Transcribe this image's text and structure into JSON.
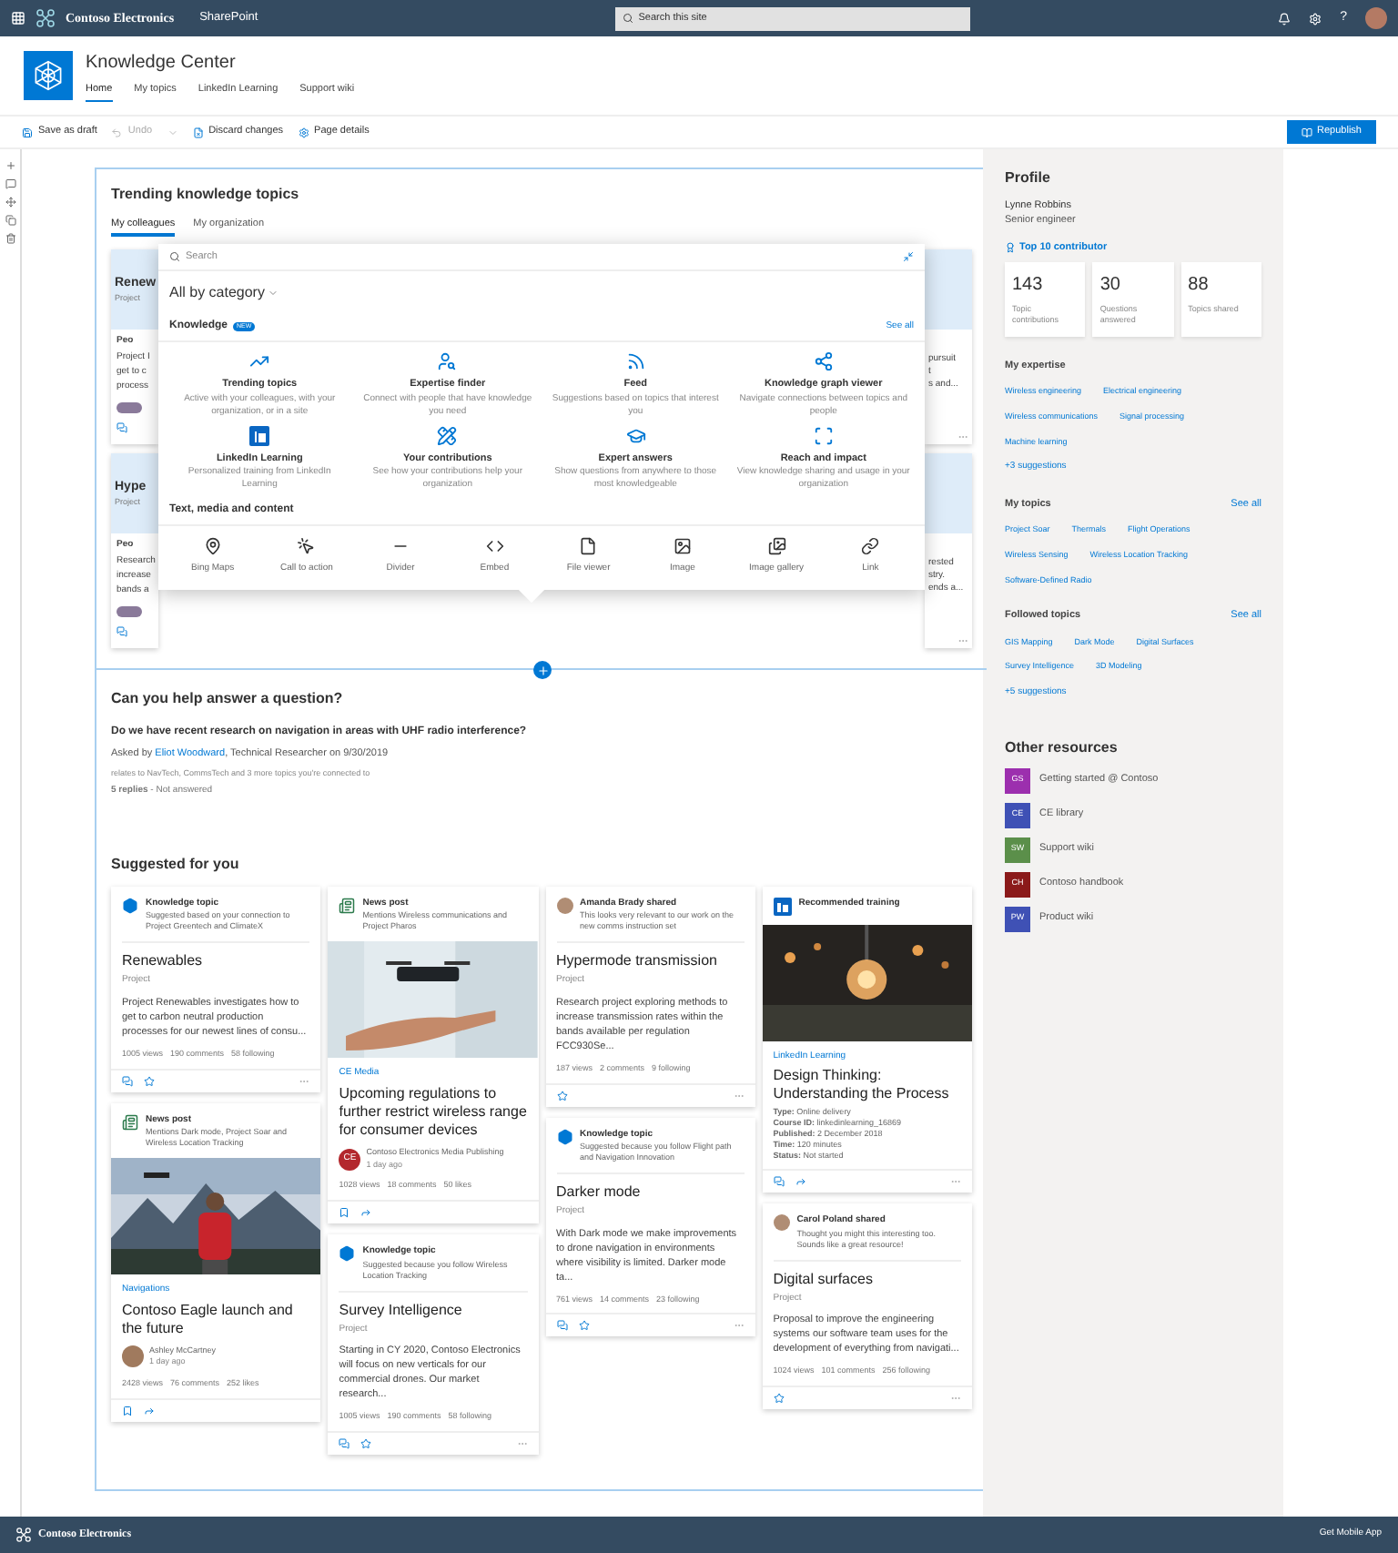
{
  "top_bar": {
    "brand": "Contoso Electronics",
    "app": "SharePoint",
    "search_placeholder": "Search this site",
    "help": "?"
  },
  "site": {
    "title": "Knowledge Center",
    "nav": [
      {
        "label": "Home",
        "selected": true
      },
      {
        "label": "My topics",
        "selected": false
      },
      {
        "label": "LinkedIn Learning",
        "selected": false
      },
      {
        "label": "Support wiki",
        "selected": false
      }
    ]
  },
  "command_bar": {
    "actions": [
      {
        "label": "Save as draft",
        "disabled": false
      },
      {
        "label": "Undo",
        "disabled": true
      },
      {
        "label": "Discard changes",
        "disabled": false
      },
      {
        "label": "Page details",
        "disabled": false
      }
    ],
    "publish": "Republish"
  },
  "trending": {
    "title": "Trending knowledge topics",
    "tabs": [
      {
        "label": "My colleagues",
        "selected": true
      },
      {
        "label": "My organization",
        "selected": false
      }
    ],
    "cards": [
      {
        "title": "Renew",
        "label": "Project",
        "source": "Peo",
        "body": [
          "Project I",
          "get to c",
          "process"
        ],
        "tail": [
          "pursuit",
          "t",
          "s and..."
        ]
      },
      {
        "title": "Hype",
        "label": "Project",
        "source": "Peo",
        "body": [
          "Research",
          "increase",
          "bands a"
        ],
        "tail": [
          "rested",
          "stry.",
          "ends a..."
        ]
      }
    ]
  },
  "toolbox": {
    "search_placeholder": "Search",
    "category": "All by category",
    "knowledge": {
      "title": "Knowledge",
      "badge": "NEW",
      "see_all": "See all",
      "items": [
        {
          "title": "Trending topics",
          "description": "Active with your colleagues, with your organization, or in a site"
        },
        {
          "title": "Expertise finder",
          "description": "Connect with people that have knowledge you need"
        },
        {
          "title": "Feed",
          "description": "Suggestions based on topics that interest you"
        },
        {
          "title": "Knowledge graph viewer",
          "description": "Navigate connections between topics and people"
        },
        {
          "title": "LinkedIn Learning",
          "description": "Personalized training from LinkedIn Learning"
        },
        {
          "title": "Your contributions",
          "description": "See how your contributions help your organization"
        },
        {
          "title": "Expert answers",
          "description": "Show questions from anywhere to those most knowledgeable"
        },
        {
          "title": "Reach and impact",
          "description": "View knowledge sharing and usage in your organization"
        }
      ]
    },
    "media": {
      "title": "Text, media and content",
      "items": [
        "Bing Maps",
        "Call to action",
        "Divider",
        "Embed",
        "File viewer",
        "Image",
        "Image gallery",
        "Link"
      ]
    }
  },
  "question": {
    "title": "Can you help answer a question?",
    "text": "Do we have recent research on navigation in areas with UHF radio interference?",
    "asked_prefix": "Asked by ",
    "asker": "Eliot Woodward",
    "asked_suffix": ", Technical Researcher on 9/30/2019",
    "relates": "relates to NavTech, CommsTech and 3 more topics you're connected to",
    "status": "**5 replies** - Not answered"
  },
  "suggested": {
    "title": "Suggested for you",
    "columns": [
      [
        {
          "kind": "topic",
          "header": "Knowledge topic",
          "subheader": "Suggested based on your connection to Project Greentech and ClimateX",
          "title": "Renewables",
          "label": "Project",
          "body": "Project Renewables investigates how to get to carbon neutral production processes for our newest lines of consu...",
          "stats": [
            "1005 views",
            "190 comments",
            "58 following"
          ],
          "actions": [
            {
              "kind": "comment"
            },
            {
              "kind": "star"
            }
          ]
        },
        {
          "kind": "news",
          "header": "News post",
          "subheader": "Mentions Dark mode, Project Soar and Wireless Location Tracking",
          "picture": true,
          "tag": "Navigations",
          "title": "Contoso Eagle launch and the future",
          "author": {
            "name": "Ashley McCartney",
            "time": "1 day ago"
          },
          "stats": [
            "2428 views",
            "76 comments",
            "252 likes"
          ],
          "actions": [
            {
              "kind": "bookmark"
            },
            {
              "kind": "share"
            }
          ]
        }
      ],
      [
        {
          "kind": "news",
          "header": "News post",
          "subheader": "Mentions Wireless communications and Project Pharos",
          "picture": true,
          "tag": "CE Media",
          "title": "Upcoming regulations to further restrict wireless range for consumer devices",
          "author": {
            "initials": "CE",
            "name": "Contoso Electronics Media Publishing",
            "time": "1 day ago"
          },
          "stats": [
            "1028 views",
            "18 comments",
            "50 likes"
          ],
          "actions": [
            {
              "kind": "bookmark"
            },
            {
              "kind": "share"
            }
          ]
        },
        {
          "kind": "topic",
          "header": "Knowledge topic",
          "subheader": "Suggested because you follow Wireless Location Tracking",
          "title": "Survey Intelligence",
          "label": "Project",
          "body": "Starting in CY 2020, Contoso Electronics will focus on new verticals for our commercial drones. Our market research...",
          "stats": [
            "1005 views",
            "190 comments",
            "58 following"
          ],
          "actions": [
            {
              "kind": "comment"
            },
            {
              "kind": "star"
            }
          ]
        }
      ],
      [
        {
          "kind": "shared",
          "header": "Amanda Brady shared",
          "subheader": "This looks very relevant to our work on the new comms instruction set",
          "title": "Hypermode transmission",
          "label": "Project",
          "body": "Research project exploring methods to increase transmission rates within the bands available per regulation FCC930Se...",
          "stats": [
            "187 views",
            "2 comments",
            "9 following"
          ],
          "actions": [
            {
              "kind": "star"
            }
          ]
        },
        {
          "kind": "topic",
          "header": "Knowledge topic",
          "subheader": "Suggested because you follow Flight path and Navigation Innovation",
          "title": "Darker mode",
          "label": "Project",
          "body": "With Dark mode we make improvements to drone navigation in environments where visibility is limited. Darker mode ta...",
          "stats": [
            "761 views",
            "14 comments",
            "23 following"
          ],
          "actions": [
            {
              "kind": "comment"
            },
            {
              "kind": "star"
            }
          ]
        }
      ],
      [
        {
          "kind": "training",
          "header": "Recommended training",
          "picture": true,
          "title": "Design Thinking: Understanding the Process",
          "tag": "LinkedIn Learning",
          "details": [
            "**Type:** Online delivery",
            "**Course ID:** linkedinlearning_16869",
            "**Published:** 2 December 2018",
            "**Time:** 120 minutes",
            "**Status:** Not started"
          ],
          "actions": [
            {
              "kind": "comment"
            },
            {
              "kind": "share"
            }
          ]
        },
        {
          "kind": "shared",
          "header": "Carol Poland shared",
          "subheader": "Thought you might this interesting too. Sounds like a great resource!",
          "title": "Digital surfaces",
          "label": "Project",
          "body": "Proposal to improve the engineering systems our software team uses for the development of everything from navigati...",
          "stats": [
            "1024 views",
            "101 comments",
            "256 following"
          ],
          "actions": [
            {
              "kind": "star"
            }
          ]
        }
      ]
    ]
  },
  "profile": {
    "title": "Profile",
    "name": "Lynne Robbins",
    "role": "Senior engineer",
    "badge": "Top 10 contributor",
    "stats": [
      {
        "value": "143",
        "label": "Topic contributions"
      },
      {
        "value": "30",
        "label": "Questions answered"
      },
      {
        "value": "88",
        "label": "Topics shared"
      }
    ],
    "groups": [
      {
        "title": "My expertise",
        "tags": [
          "Wireless engineering",
          "Electrical engineering",
          "Wireless communications",
          "Signal processing",
          "Machine learning"
        ],
        "more": "+3 suggestions"
      },
      {
        "title": "My topics",
        "see_all": "See all",
        "tags": [
          "Project Soar",
          "Thermals",
          "Flight Operations",
          "Wireless Sensing",
          "Wireless Location Tracking",
          "Software-Defined Radio"
        ]
      },
      {
        "title": "Followed topics",
        "see_all": "See all",
        "tags": [
          "GIS Mapping",
          "Dark Mode",
          "Digital Surfaces",
          "Survey Intelligence",
          "3D Modeling"
        ],
        "more": "+5 suggestions"
      }
    ]
  },
  "resources": {
    "title": "Other resources",
    "items": [
      {
        "initials": "GS",
        "label": "Getting started @ Contoso",
        "color": "#9c2fae"
      },
      {
        "initials": "CE",
        "label": "CE library",
        "color": "#3f51b5"
      },
      {
        "initials": "SW",
        "label": "Support wiki",
        "color": "#5b8f4a"
      },
      {
        "initials": "CH",
        "label": "Contoso handbook",
        "color": "#8b1a1a"
      },
      {
        "initials": "PW",
        "label": "Product wiki",
        "color": "#3f51b5"
      }
    ]
  },
  "footer": {
    "brand": "Contoso Electronics",
    "link": "Get Mobile App"
  }
}
